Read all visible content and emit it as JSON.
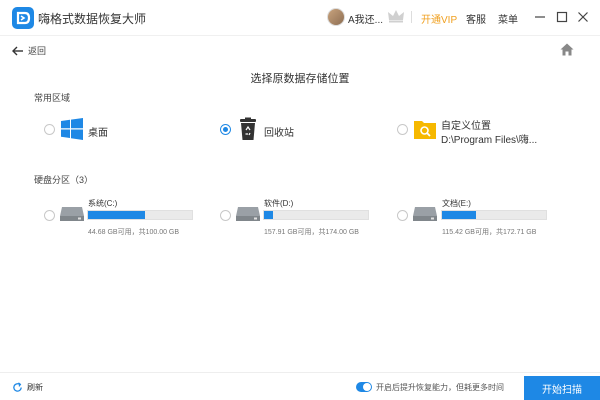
{
  "app": {
    "title": "嗨格式数据恢复大师",
    "username": "A我还...",
    "vip_label": "开通VIP",
    "service_label": "客服",
    "menu_label": "菜单"
  },
  "nav": {
    "back_label": "返回"
  },
  "main": {
    "title": "选择原数据存储位置",
    "common_section_label": "常用区域",
    "disk_section_label": "硬盘分区（3）"
  },
  "locations": [
    {
      "label": "桌面",
      "icon": "windows-icon",
      "selected": false
    },
    {
      "label": "回收站",
      "icon": "recycle-bin-icon",
      "selected": true
    },
    {
      "label": "自定义位置",
      "sublabel": "D:\\Program Files\\嗨...",
      "icon": "folder-search-icon",
      "selected": false
    }
  ],
  "drives": [
    {
      "name": "系统(C:)",
      "info": "44.68 GB可用，共100.00 GB",
      "used_fraction": 0.55
    },
    {
      "name": "软件(D:)",
      "info": "157.91 GB可用，共174.00 GB",
      "used_fraction": 0.09
    },
    {
      "name": "文档(E:)",
      "info": "115.42 GB可用，共172.71 GB",
      "used_fraction": 0.33
    }
  ],
  "footer": {
    "refresh_label": "刷新",
    "toggle_label": "开启后提升恢复能力，但耗更多时间",
    "toggle_on": true,
    "scan_label": "开始扫描"
  },
  "colors": {
    "accent": "#1e88e5",
    "vip": "#f0a020",
    "folder": "#f6b800"
  }
}
